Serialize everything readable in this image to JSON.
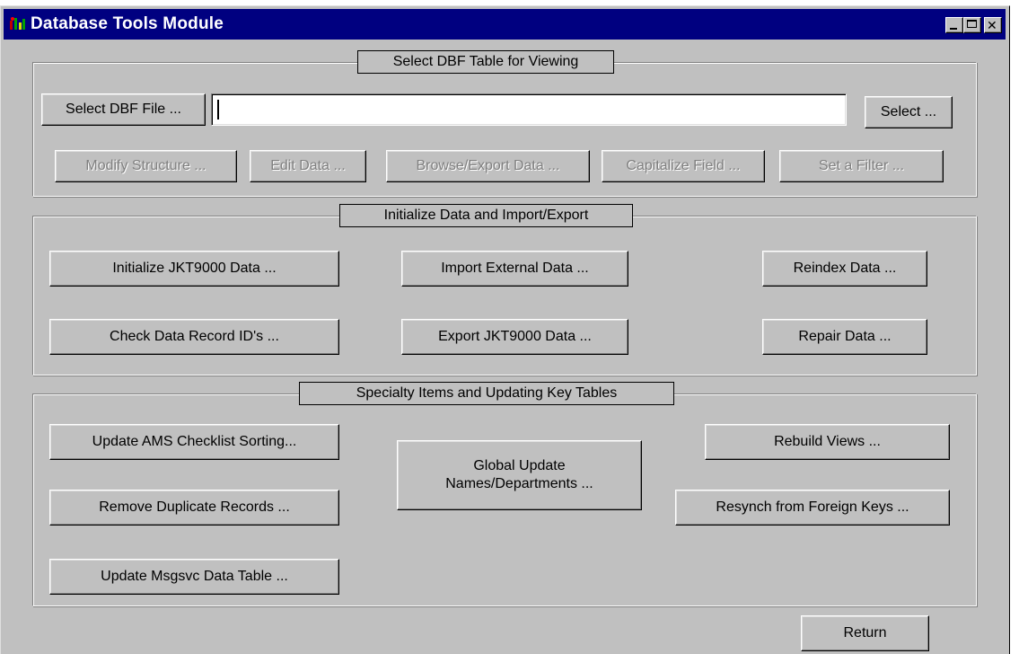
{
  "window": {
    "title": "Database Tools Module",
    "controls": {
      "minimize_icon": "minimize-icon",
      "maximize_icon": "maximize-icon",
      "close_icon": "close-icon"
    }
  },
  "select_group": {
    "legend": "Select DBF Table for Viewing",
    "select_file_button": "Select DBF File ...",
    "file_path_value": "",
    "select_button": "Select ...",
    "modify_structure_button": "Modify Structure ...",
    "edit_data_button": "Edit Data ...",
    "browse_export_button": "Browse/Export Data ...",
    "capitalize_field_button": "Capitalize Field ...",
    "set_filter_button": "Set a Filter ..."
  },
  "init_group": {
    "legend": "Initialize Data and Import/Export",
    "initialize_button": "Initialize JKT9000 Data ...",
    "import_button": "Import External Data ...",
    "reindex_button": "Reindex Data ...",
    "check_ids_button": "Check Data Record ID's ...",
    "export_button": "Export JKT9000 Data ...",
    "repair_button": "Repair Data ..."
  },
  "specialty_group": {
    "legend": "Specialty Items and Updating Key Tables",
    "update_ams_button": "Update AMS Checklist Sorting...",
    "global_update_line1": "Global Update",
    "global_update_line2": "Names/Departments ...",
    "rebuild_views_button": "Rebuild Views ...",
    "remove_duplicates_button": "Remove Duplicate Records ...",
    "resynch_button": "Resynch from Foreign Keys ...",
    "update_msgsvc_button": "Update Msgsvc Data Table ..."
  },
  "footer": {
    "return_button": "Return"
  }
}
